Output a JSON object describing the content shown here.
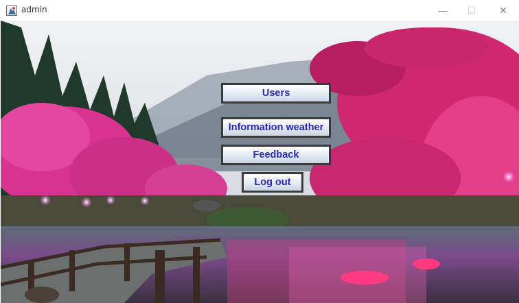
{
  "window": {
    "title": "admin",
    "icons": [
      "app-icon",
      "minimize-icon",
      "maximize-icon",
      "close-icon"
    ],
    "controls": {
      "minimize": "—",
      "maximize": "☐",
      "close": "✕"
    }
  },
  "background": {
    "description_icon": "cherry-blossom-lake-photo"
  },
  "menu": {
    "users_label": "Users",
    "weather_label": "Information weather",
    "feedback_label": "Feedback",
    "logout_label": "Log out"
  },
  "colors": {
    "button_text": "#2727c4",
    "button_border": "#3a3a3a"
  }
}
